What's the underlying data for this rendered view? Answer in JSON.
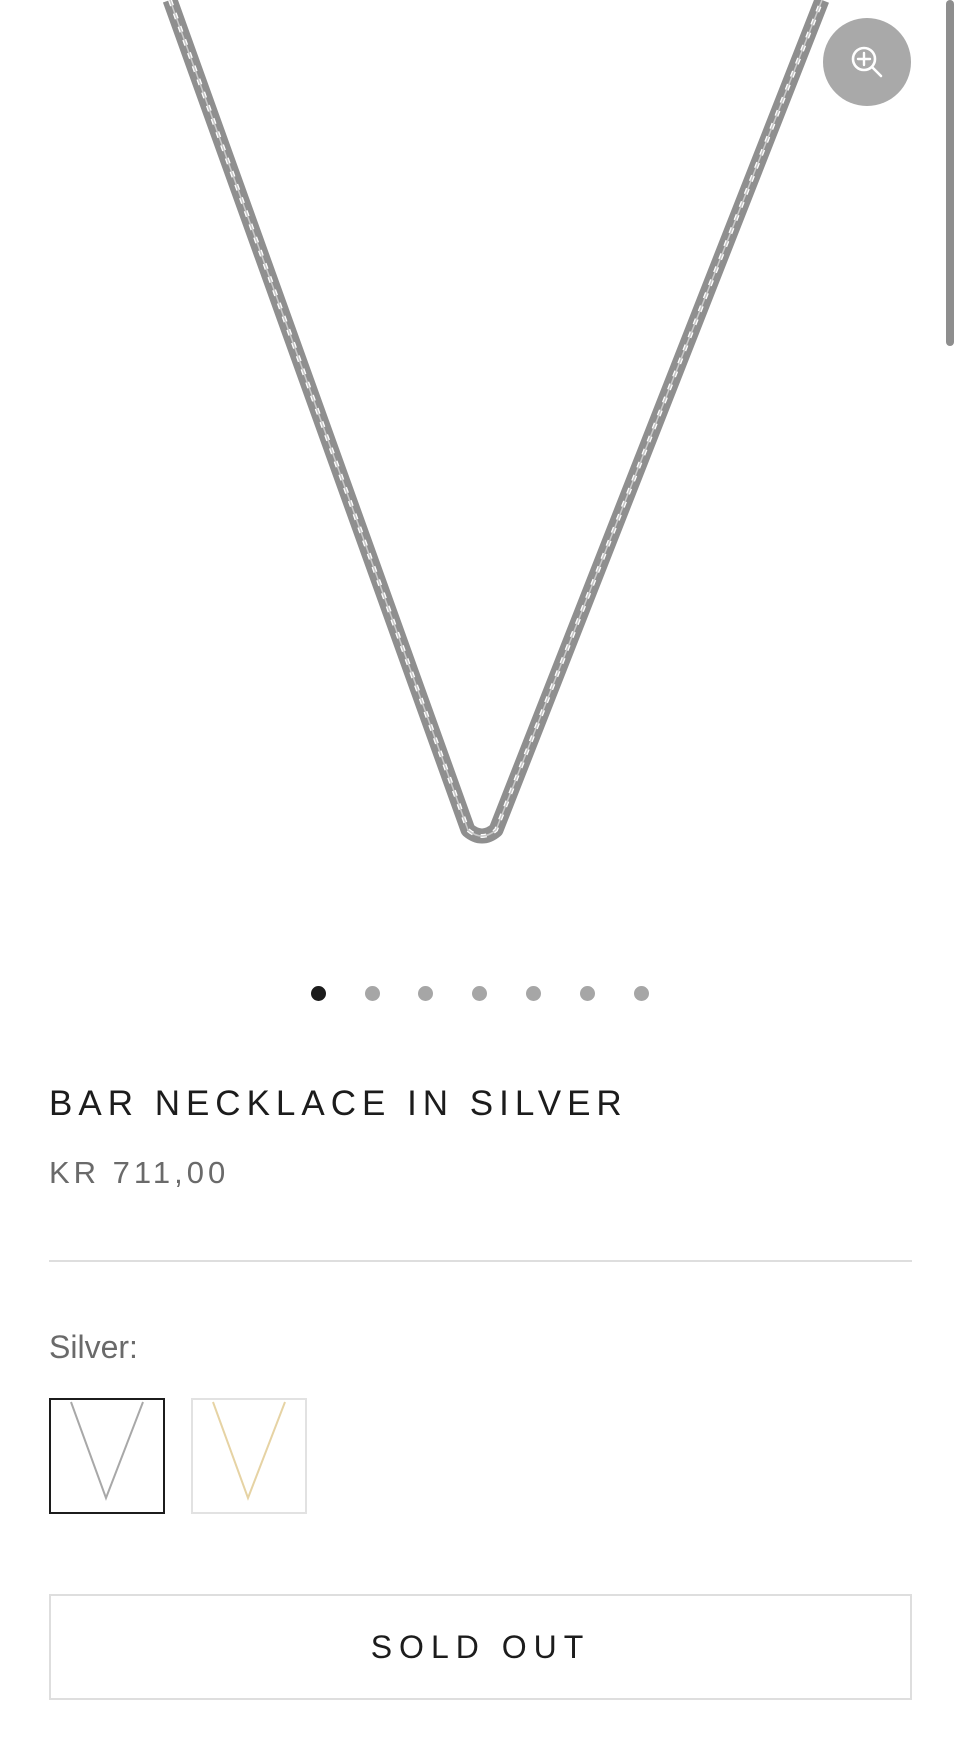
{
  "product": {
    "title": "BAR NECKLACE IN SILVER",
    "price": "KR 711,00"
  },
  "gallery": {
    "image_count": 7,
    "active_index": 0,
    "zoom_icon": "zoom-in-icon"
  },
  "variant": {
    "label": "Silver:",
    "options": [
      {
        "name": "Silver",
        "selected": true,
        "color": "#a8a8a8"
      },
      {
        "name": "Gold",
        "selected": false,
        "color": "#e6d3a4"
      }
    ]
  },
  "actions": {
    "sold_out_label": "SOLD OUT"
  },
  "colors": {
    "text": "#1c1c1c",
    "muted": "#6a6a6a",
    "zoom_bg": "#a9a9a9",
    "chain": "#9a9a9a"
  }
}
